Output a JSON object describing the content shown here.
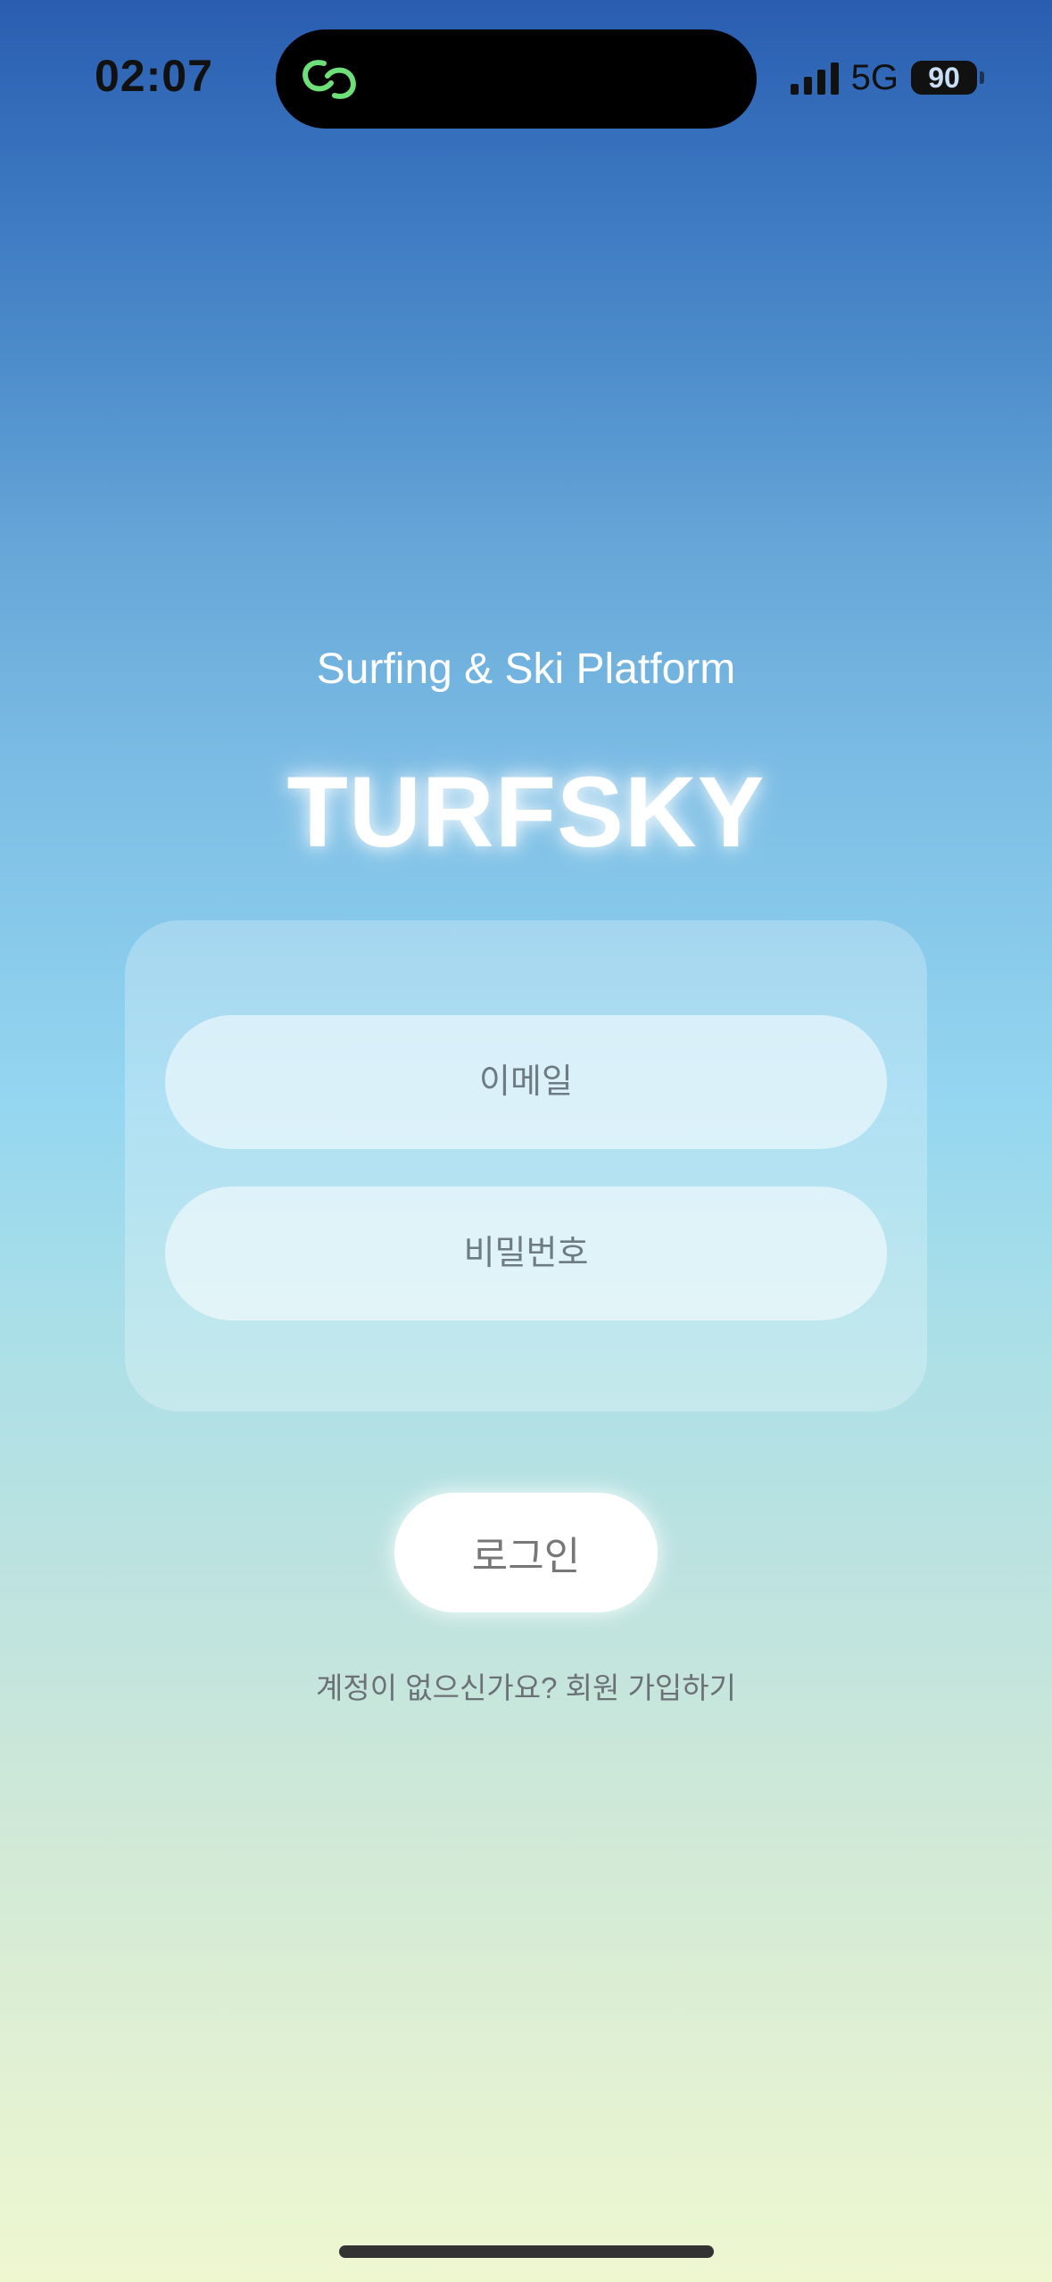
{
  "status_bar": {
    "time": "02:07",
    "network": "5G",
    "battery": "90",
    "island_icon": "link-icon",
    "island_icon_color": "#6ee07a"
  },
  "login": {
    "subtitle": "Surfing & Ski Platform",
    "app_name": "TURFSKY",
    "email_placeholder": "이메일",
    "password_placeholder": "비밀번호",
    "login_button": "로그인",
    "signup_link": "계정이 없으신가요? 회원 가입하기"
  }
}
